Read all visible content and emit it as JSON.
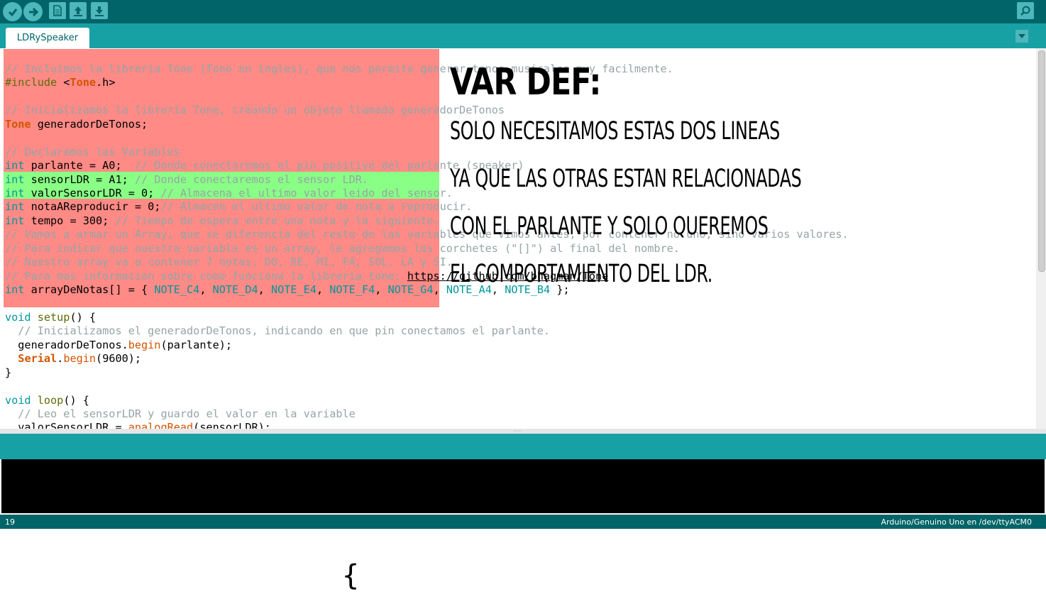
{
  "toolbar": {
    "buttons": [
      "verify-icon",
      "upload-icon",
      "new-icon",
      "open-icon",
      "save-icon"
    ],
    "serial_monitor": "magnifier-icon"
  },
  "tabs": [
    {
      "label": "LDRySpeaker"
    }
  ],
  "status": {
    "line": "19",
    "board": "Arduino/Genuino Uno en /dev/ttyACM0"
  },
  "annotation": {
    "title": "VAR DEF:",
    "lines": [
      "SOLO NECESITAMOS ESTAS DOS LINEAS",
      "YA QUE LAS OTRAS ESTAN RELACIONADAS",
      "CON EL PARLANTE Y SOLO QUEREMOS",
      "EL COMPORTAMIENTO DEL LDR."
    ]
  },
  "brace": "{",
  "code_lines": [
    [
      [
        "cm",
        "// Incluimos la libreria Tone (Tono en ingles), que nos permite generar tonos musicales muy facilmente."
      ]
    ],
    [
      [
        "pp",
        "#include "
      ],
      [
        "txt",
        "<"
      ],
      [
        "cl",
        "Tone"
      ],
      [
        "txt",
        ".h>"
      ]
    ],
    [],
    [
      [
        "cm",
        "// Inicializamos la libreria Tone, creando un objeto llamado generadorDeTonos"
      ]
    ],
    [
      [
        "cl",
        "Tone"
      ],
      [
        "txt",
        " generadorDeTonos;"
      ]
    ],
    [],
    [
      [
        "cm",
        "// Declaramos las Variables"
      ]
    ],
    [
      [
        "kw",
        "int"
      ],
      [
        "txt",
        " parlante = A0;  "
      ],
      [
        "cm",
        "// Donde conectaremos el pin positivo del parlante (speaker)"
      ]
    ],
    [
      [
        "kw",
        "int"
      ],
      [
        "txt",
        " sensorLDR = A1; "
      ],
      [
        "cm",
        "// Donde conectaremos el sensor LDR."
      ]
    ],
    [
      [
        "kw",
        "int"
      ],
      [
        "txt",
        " valorSensorLDR = 0; "
      ],
      [
        "cm",
        "// Almacena el ultimo valor leido del sensor."
      ]
    ],
    [
      [
        "kw",
        "int"
      ],
      [
        "txt",
        " notaAReproducir = 0;"
      ],
      [
        "cm",
        "// Almacen el ultimo valor de nota a reproducir."
      ]
    ],
    [
      [
        "kw",
        "int"
      ],
      [
        "txt",
        " tempo = 300; "
      ],
      [
        "cm",
        "// Tiempo de espera entre una nota y la siguiente."
      ]
    ],
    [
      [
        "cm",
        "// Vamos a armar un Array, que se diferencia del resto de las variables que vimos antes, por contener no uno, sino varios valores."
      ]
    ],
    [
      [
        "cm",
        "// Para indicar que nuestra variable es un array, le agregamos los corchetes (\"[]\") al final del nombre."
      ]
    ],
    [
      [
        "cm",
        "// Nuestro array va a contener 7 notas, DO, RE, MI, FA, SOL, LA y SI."
      ]
    ],
    [
      [
        "cm",
        "// Para mas informacion sobre como funciona la libreria tone: "
      ],
      [
        "lnk",
        "https://github.com/bhagman/Tone"
      ]
    ],
    [
      [
        "kw",
        "int"
      ],
      [
        "txt",
        " arrayDeNotas[] = { "
      ],
      [
        "kw",
        "NOTE_C4"
      ],
      [
        "txt",
        ", "
      ],
      [
        "kw",
        "NOTE_D4"
      ],
      [
        "txt",
        ", "
      ],
      [
        "kw",
        "NOTE_E4"
      ],
      [
        "txt",
        ", "
      ],
      [
        "kw",
        "NOTE_F4"
      ],
      [
        "txt",
        ", "
      ],
      [
        "kw",
        "NOTE_G4"
      ],
      [
        "txt",
        ", "
      ],
      [
        "kw",
        "NOTE_A4"
      ],
      [
        "txt",
        ", "
      ],
      [
        "kw",
        "NOTE_B4"
      ],
      [
        "txt",
        " };"
      ]
    ],
    [],
    [
      [
        "kw",
        "void"
      ],
      [
        "txt",
        " "
      ],
      [
        "pp",
        "setup"
      ],
      [
        "txt",
        "() {"
      ]
    ],
    [
      [
        "txt",
        "  "
      ],
      [
        "cm",
        "// Inicializamos el generadorDeTonos, indicando en que pin conectamos el parlante."
      ]
    ],
    [
      [
        "txt",
        "  generadorDeTonos."
      ],
      [
        "fn",
        "begin"
      ],
      [
        "txt",
        "(parlante);"
      ]
    ],
    [
      [
        "txt",
        "  "
      ],
      [
        "cl",
        "Serial"
      ],
      [
        "txt",
        "."
      ],
      [
        "fn",
        "begin"
      ],
      [
        "txt",
        "(9600);"
      ]
    ],
    [
      [
        "txt",
        "}"
      ]
    ],
    [],
    [
      [
        "kw",
        "void"
      ],
      [
        "txt",
        " "
      ],
      [
        "pp",
        "loop"
      ],
      [
        "txt",
        "() {"
      ]
    ],
    [
      [
        "txt",
        "  "
      ],
      [
        "cm",
        "// Leo el sensorLDR y guardo el valor en la variable"
      ]
    ],
    [
      [
        "txt",
        "  valorSensorLDR = "
      ],
      [
        "fn",
        "analogRead"
      ],
      [
        "txt",
        "(sensorLDR);"
      ]
    ]
  ]
}
